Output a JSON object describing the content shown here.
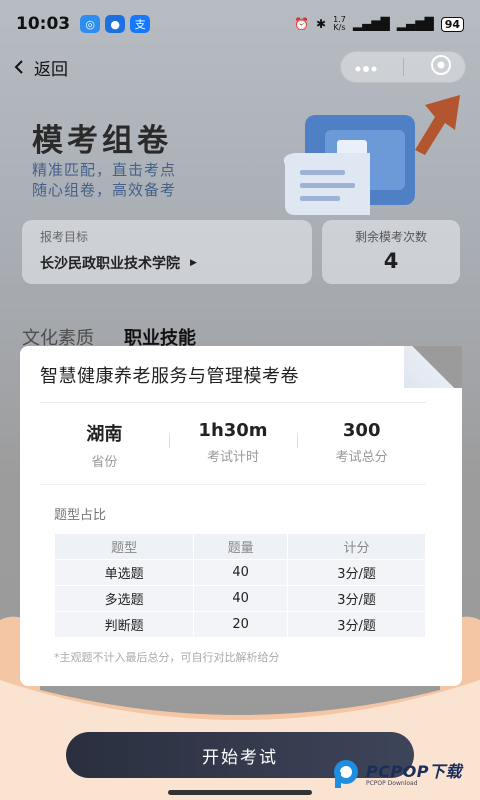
{
  "status": {
    "time": "10:03",
    "net_speed_top": "1.7",
    "net_speed_unit": "K/s",
    "battery": "94",
    "apps": [
      {
        "icon": "message-app-icon",
        "color": "#2b8ef0",
        "glyph": "◎"
      },
      {
        "icon": "chat-app-icon",
        "color": "#1e6fe0",
        "glyph": "●"
      },
      {
        "icon": "alipay-app-icon",
        "color": "#1677ff",
        "glyph": "支"
      }
    ]
  },
  "nav": {
    "back_label": "返回"
  },
  "hero": {
    "title": "模考组卷",
    "subtitle_line1": "精准匹配，直击考点",
    "subtitle_line2": "随心组卷，高效备考"
  },
  "target": {
    "label": "报考目标",
    "school": "长沙民政职业技术学院"
  },
  "remain": {
    "label": "剩余模考次数",
    "value": "4"
  },
  "tabs": [
    {
      "label": "文化素质",
      "active": false
    },
    {
      "label": "职业技能",
      "active": true
    }
  ],
  "paper": {
    "title": "智慧健康养老服务与管理模考卷",
    "stats": [
      {
        "value": "湖南",
        "label": "省份"
      },
      {
        "value": "1h30m",
        "label": "考试计时"
      },
      {
        "value": "300",
        "label": "考试总分"
      }
    ],
    "section_title": "题型占比",
    "table": {
      "headers": [
        "题型",
        "题量",
        "计分"
      ],
      "rows": [
        [
          "单选题",
          "40",
          "3分/题"
        ],
        [
          "多选题",
          "40",
          "3分/题"
        ],
        [
          "判断题",
          "20",
          "3分/题"
        ]
      ]
    },
    "footnote": "*主观题不计入最后总分，可自行对比解析给分"
  },
  "start_button": "开始考试",
  "watermark": {
    "brand": "PCPOP下载",
    "sub": "PCPOP Download"
  },
  "colors": {
    "accent": "#2f4ea8",
    "button": "#2a2f3f",
    "wave": "#f4c6a3"
  }
}
